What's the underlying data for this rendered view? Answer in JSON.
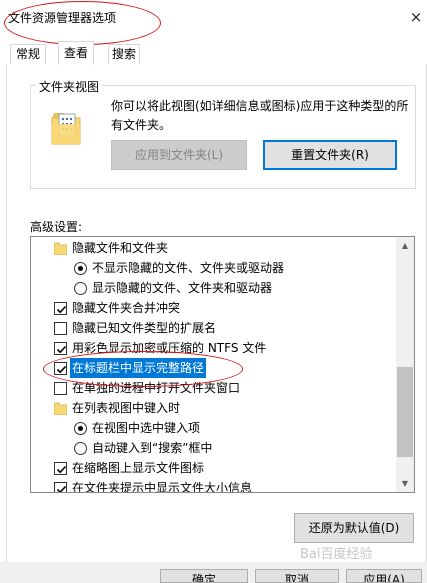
{
  "window": {
    "title": "文件资源管理器选项",
    "close_glyph": "×"
  },
  "tabs": [
    {
      "label": "常规"
    },
    {
      "label": "查看"
    },
    {
      "label": "搜索"
    }
  ],
  "folder_views": {
    "group_title": "文件夹视图",
    "description": "你可以将此视图(如详细信息或图标)应用于这种类型的所有文件夹。",
    "apply_button": "应用到文件夹(L)",
    "reset_button": "重置文件夹(R)"
  },
  "advanced": {
    "label": "高级设置:",
    "items": [
      {
        "kind": "folder",
        "label": "隐藏文件和文件夹"
      },
      {
        "kind": "radio",
        "checked": true,
        "label": "不显示隐藏的文件、文件夹或驱动器"
      },
      {
        "kind": "radio",
        "checked": false,
        "label": "显示隐藏的文件、文件夹和驱动器"
      },
      {
        "kind": "check",
        "checked": true,
        "label": "隐藏文件夹合并冲突"
      },
      {
        "kind": "check",
        "checked": false,
        "label": "隐藏已知文件类型的扩展名"
      },
      {
        "kind": "check",
        "checked": true,
        "label": "用彩色显示加密或压缩的 NTFS 文件"
      },
      {
        "kind": "check",
        "checked": true,
        "selected": true,
        "label": "在标题栏中显示完整路径"
      },
      {
        "kind": "check",
        "checked": false,
        "label": "在单独的进程中打开文件夹窗口"
      },
      {
        "kind": "folder",
        "label": "在列表视图中键入时"
      },
      {
        "kind": "radio",
        "checked": true,
        "label": "在视图中选中键入项"
      },
      {
        "kind": "radio",
        "checked": false,
        "label": "自动键入到“搜索”框中"
      },
      {
        "kind": "check",
        "checked": true,
        "label": "在缩略图上显示文件图标"
      },
      {
        "kind": "check",
        "checked": true,
        "label": "在文件夹提示中显示文件大小信息"
      }
    ]
  },
  "restore_button": "还原为默认值(D)",
  "footer_buttons": [
    "确定",
    "取消",
    "应用(A)"
  ],
  "watermark": "Bai百度经验",
  "colors": {
    "accent": "#0078d7",
    "annotation_red": "#d01818",
    "folder_yellow": "#f8d775"
  }
}
